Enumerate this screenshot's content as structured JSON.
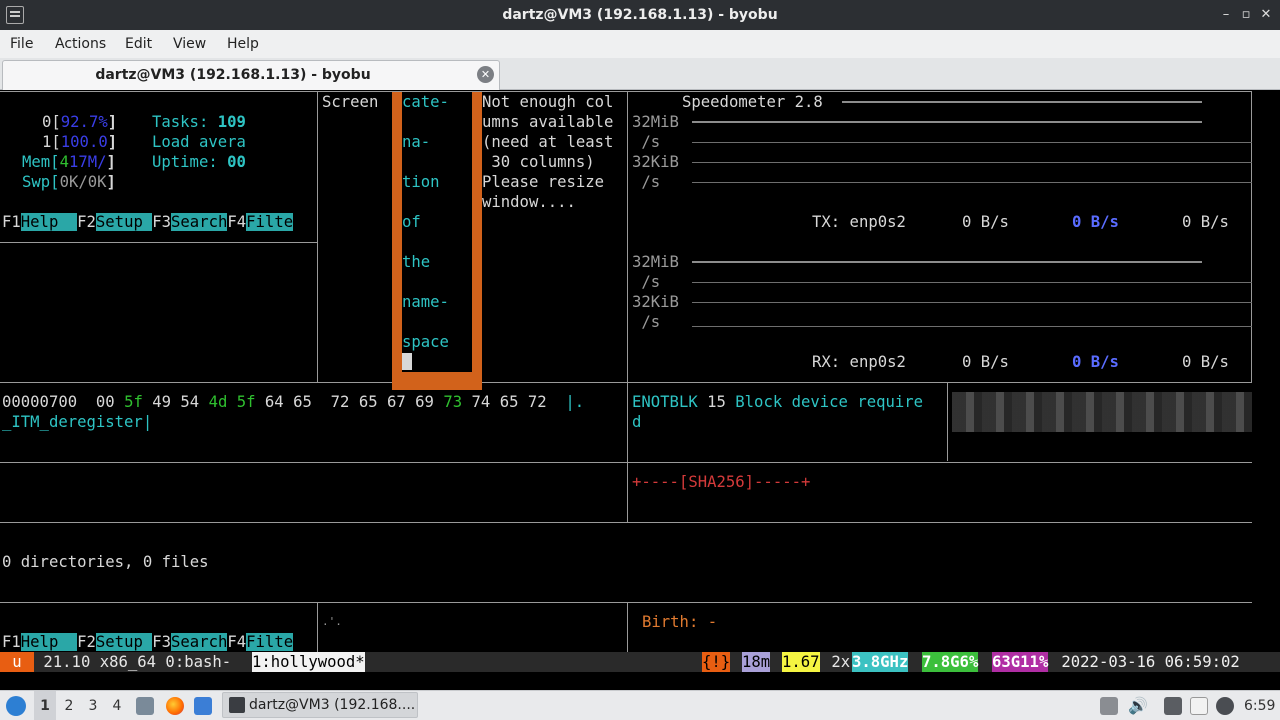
{
  "window": {
    "title": "dartz@VM3 (192.168.1.13) - byobu",
    "controls": [
      "–",
      "▫",
      "✕"
    ]
  },
  "menu": [
    "File",
    "Actions",
    "Edit",
    "View",
    "Help"
  ],
  "tab": {
    "label": "dartz@VM3 (192.168.1.13) - byobu"
  },
  "htop": {
    "cpu0_label": "0[",
    "cpu0_val": "92.7%",
    "cpu0_end": "]",
    "cpu1_label": "1[",
    "cpu1_val": "100.0",
    "cpu1_end": "]",
    "mem_label": "Mem[",
    "mem_a": "4",
    "mem_b": "17M/",
    "mem_end": "]",
    "swp_label": "Swp[",
    "swp_val": "0K/0K",
    "swp_end": "]",
    "tasks_label": "Tasks: ",
    "tasks_val": "109",
    "load_label": "Load avera",
    "uptime_label": "Uptime: ",
    "uptime_val": "00",
    "keys": [
      {
        "num": "F1",
        "label": "Help  "
      },
      {
        "num": "F2",
        "label": "Setup "
      },
      {
        "num": "F3",
        "label": "Search"
      },
      {
        "num": "F4",
        "label": "Filte"
      }
    ]
  },
  "screen_pane": {
    "label": "Screen",
    "words": [
      "cate-",
      "na-",
      "tion",
      "of",
      "the",
      "name-",
      "space"
    ]
  },
  "resize_msg": [
    "Not enough col",
    "umns available",
    "(need at least",
    " 30 columns)",
    "Please resize",
    "window...."
  ],
  "speedometer": {
    "title": "Speedometer 2.8",
    "tx": {
      "lbl1": "32MiB",
      "lbl2": " /s",
      "lbl3": "32KiB",
      "lbl4": " /s",
      "iface": "TX: enp0s2",
      "v1": "0 B/s",
      "v2": "0 B/s",
      "v3": "0 B/s"
    },
    "rx": {
      "lbl1": "32MiB",
      "lbl2": " /s",
      "lbl3": "32KiB",
      "lbl4": " /s",
      "iface": "RX: enp0s2",
      "v1": "0 B/s",
      "v2": "0 B/s",
      "v3": "0 B/s"
    }
  },
  "hexdump": {
    "offset": "00000700",
    "bytes": [
      "00",
      "5f",
      "49",
      "54",
      "4d",
      "5f",
      "64",
      "65",
      "72",
      "65",
      "67",
      "69",
      "73",
      "74",
      "65",
      "72"
    ],
    "ascii1": "|.",
    "ascii2": "_ITM_deregister|"
  },
  "errno": {
    "name": "ENOTBLK",
    "code": "15",
    "msg1": "Block device require",
    "msg2": "d"
  },
  "sha_box": "+----[SHA256]-----+",
  "tree_summary": "0 directories, 0 files",
  "birth": "Birth: -",
  "dots": ".'.",
  "statusbar": {
    "logo": "u",
    "release": " 21.10 x86_64 0:bash- ",
    "window_active": "1:hollywood*",
    "alert": "{!}",
    "uptime": "18m",
    "load": "1.67",
    "cpu_count": " 2x",
    "cpu_freq": "3.8GHz",
    "mem": "7.8G6%",
    "disk": "63G11%",
    "datetime": " 2022-03-16 06:59:02"
  },
  "taskbar": {
    "workspaces": [
      "1",
      "2",
      "3",
      "4"
    ],
    "task_label": "dartz@VM3 (192.168....",
    "clock": "6:59"
  }
}
